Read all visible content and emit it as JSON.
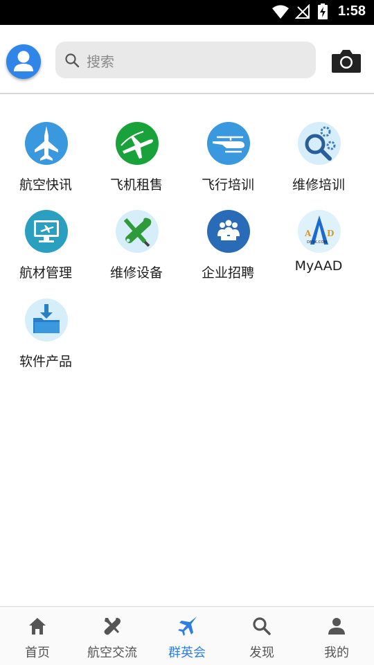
{
  "status_bar": {
    "time": "1:58"
  },
  "header": {
    "search_placeholder": "搜索"
  },
  "grid": {
    "items": [
      {
        "label": "航空快讯",
        "icon": "fighter-jet-icon"
      },
      {
        "label": "飞机租售",
        "icon": "airplane-icon"
      },
      {
        "label": "飞行培训",
        "icon": "helicopter-icon"
      },
      {
        "label": "维修培训",
        "icon": "gear-magnifier-icon"
      },
      {
        "label": "航材管理",
        "icon": "monitor-plane-icon"
      },
      {
        "label": "维修设备",
        "icon": "tools-icon"
      },
      {
        "label": "企业招聘",
        "icon": "people-icon"
      },
      {
        "label": "MyAAD",
        "icon": "aad-logo-icon"
      },
      {
        "label": "软件产品",
        "icon": "folder-download-icon"
      }
    ]
  },
  "bottom_nav": {
    "items": [
      {
        "label": "首页",
        "icon": "home-icon"
      },
      {
        "label": "航空交流",
        "icon": "tools-icon"
      },
      {
        "label": "群英会",
        "icon": "jet-icon",
        "active": true
      },
      {
        "label": "发现",
        "icon": "search-icon"
      },
      {
        "label": "我的",
        "icon": "person-icon"
      }
    ]
  },
  "colors": {
    "accent": "#2f7fe0",
    "status_bar": "#000000",
    "search_bg": "#e9e9e9"
  },
  "logo_text": {
    "aad_small": "DESK.COM"
  }
}
